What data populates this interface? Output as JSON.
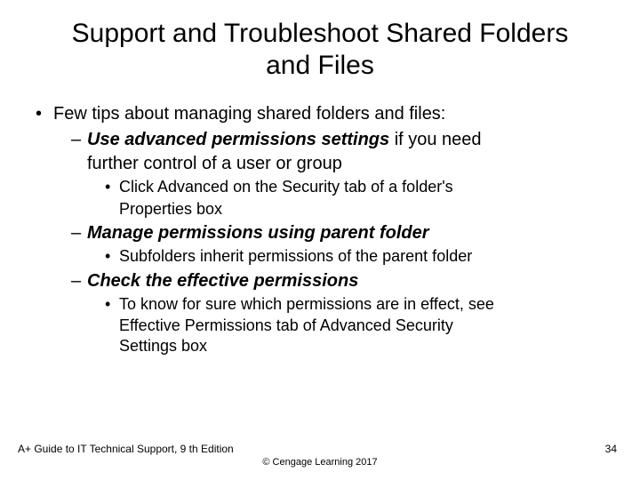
{
  "title": "Support and Troubleshoot Shared Folders and Files",
  "lvl1_text": "Few tips about managing shared folders and files:",
  "tip1": {
    "bold": "Use advanced permissions settings",
    "rest": " if you need",
    "cont": "further control of a user or group"
  },
  "tip1_sub_a": "Click Advanced on the Security tab of a folder's",
  "tip1_sub_a_cont": "Properties box",
  "tip2": {
    "bold": "Manage permissions using parent folder"
  },
  "tip2_sub_a": "Subfolders inherit permissions of the parent folder",
  "tip3": {
    "bold": "Check the effective permissions"
  },
  "tip3_sub_a": "To know for sure which permissions are in effect, see",
  "tip3_sub_b": "Effective Permissions tab of Advanced Security",
  "tip3_sub_c": "Settings box",
  "footer_left": "A+ Guide to IT Technical Support, 9 th Edition",
  "footer_center": "©  Cengage Learning 2017",
  "footer_right": "34"
}
